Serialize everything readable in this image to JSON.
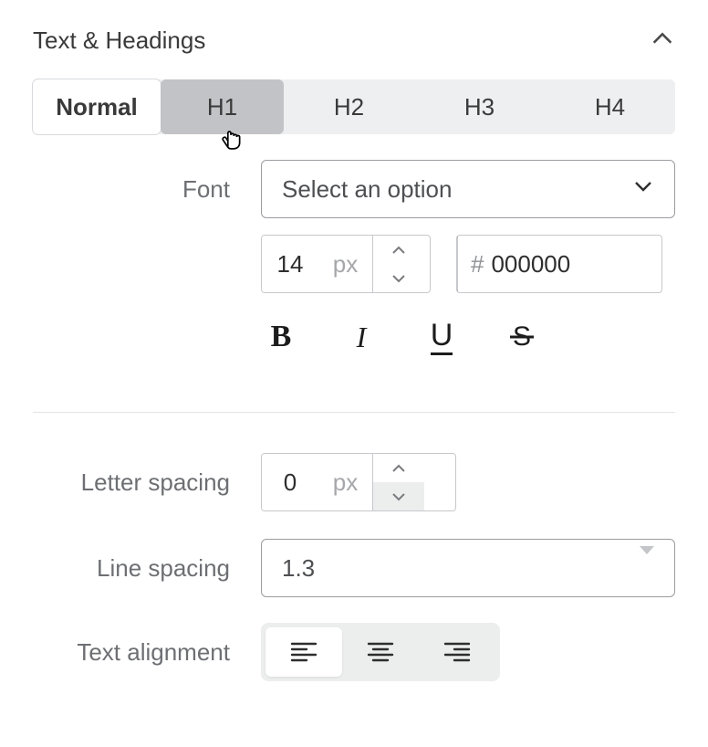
{
  "section": {
    "title": "Text & Headings"
  },
  "tabs": {
    "items": [
      "Normal",
      "H1",
      "H2",
      "H3",
      "H4"
    ],
    "active_index": 0,
    "hover_index": 1
  },
  "font": {
    "label": "Font",
    "select_placeholder": "Select an option",
    "size_value": "14",
    "size_unit": "px",
    "color_hex": "000000",
    "color_swatch": "#000000"
  },
  "format": {
    "bold": "B",
    "italic": "I",
    "underline": "U",
    "strike": "S"
  },
  "letter_spacing": {
    "label": "Letter spacing",
    "value": "0",
    "unit": "px"
  },
  "line_spacing": {
    "label": "Line spacing",
    "value": "1.3"
  },
  "text_alignment": {
    "label": "Text alignment",
    "active": "left"
  }
}
